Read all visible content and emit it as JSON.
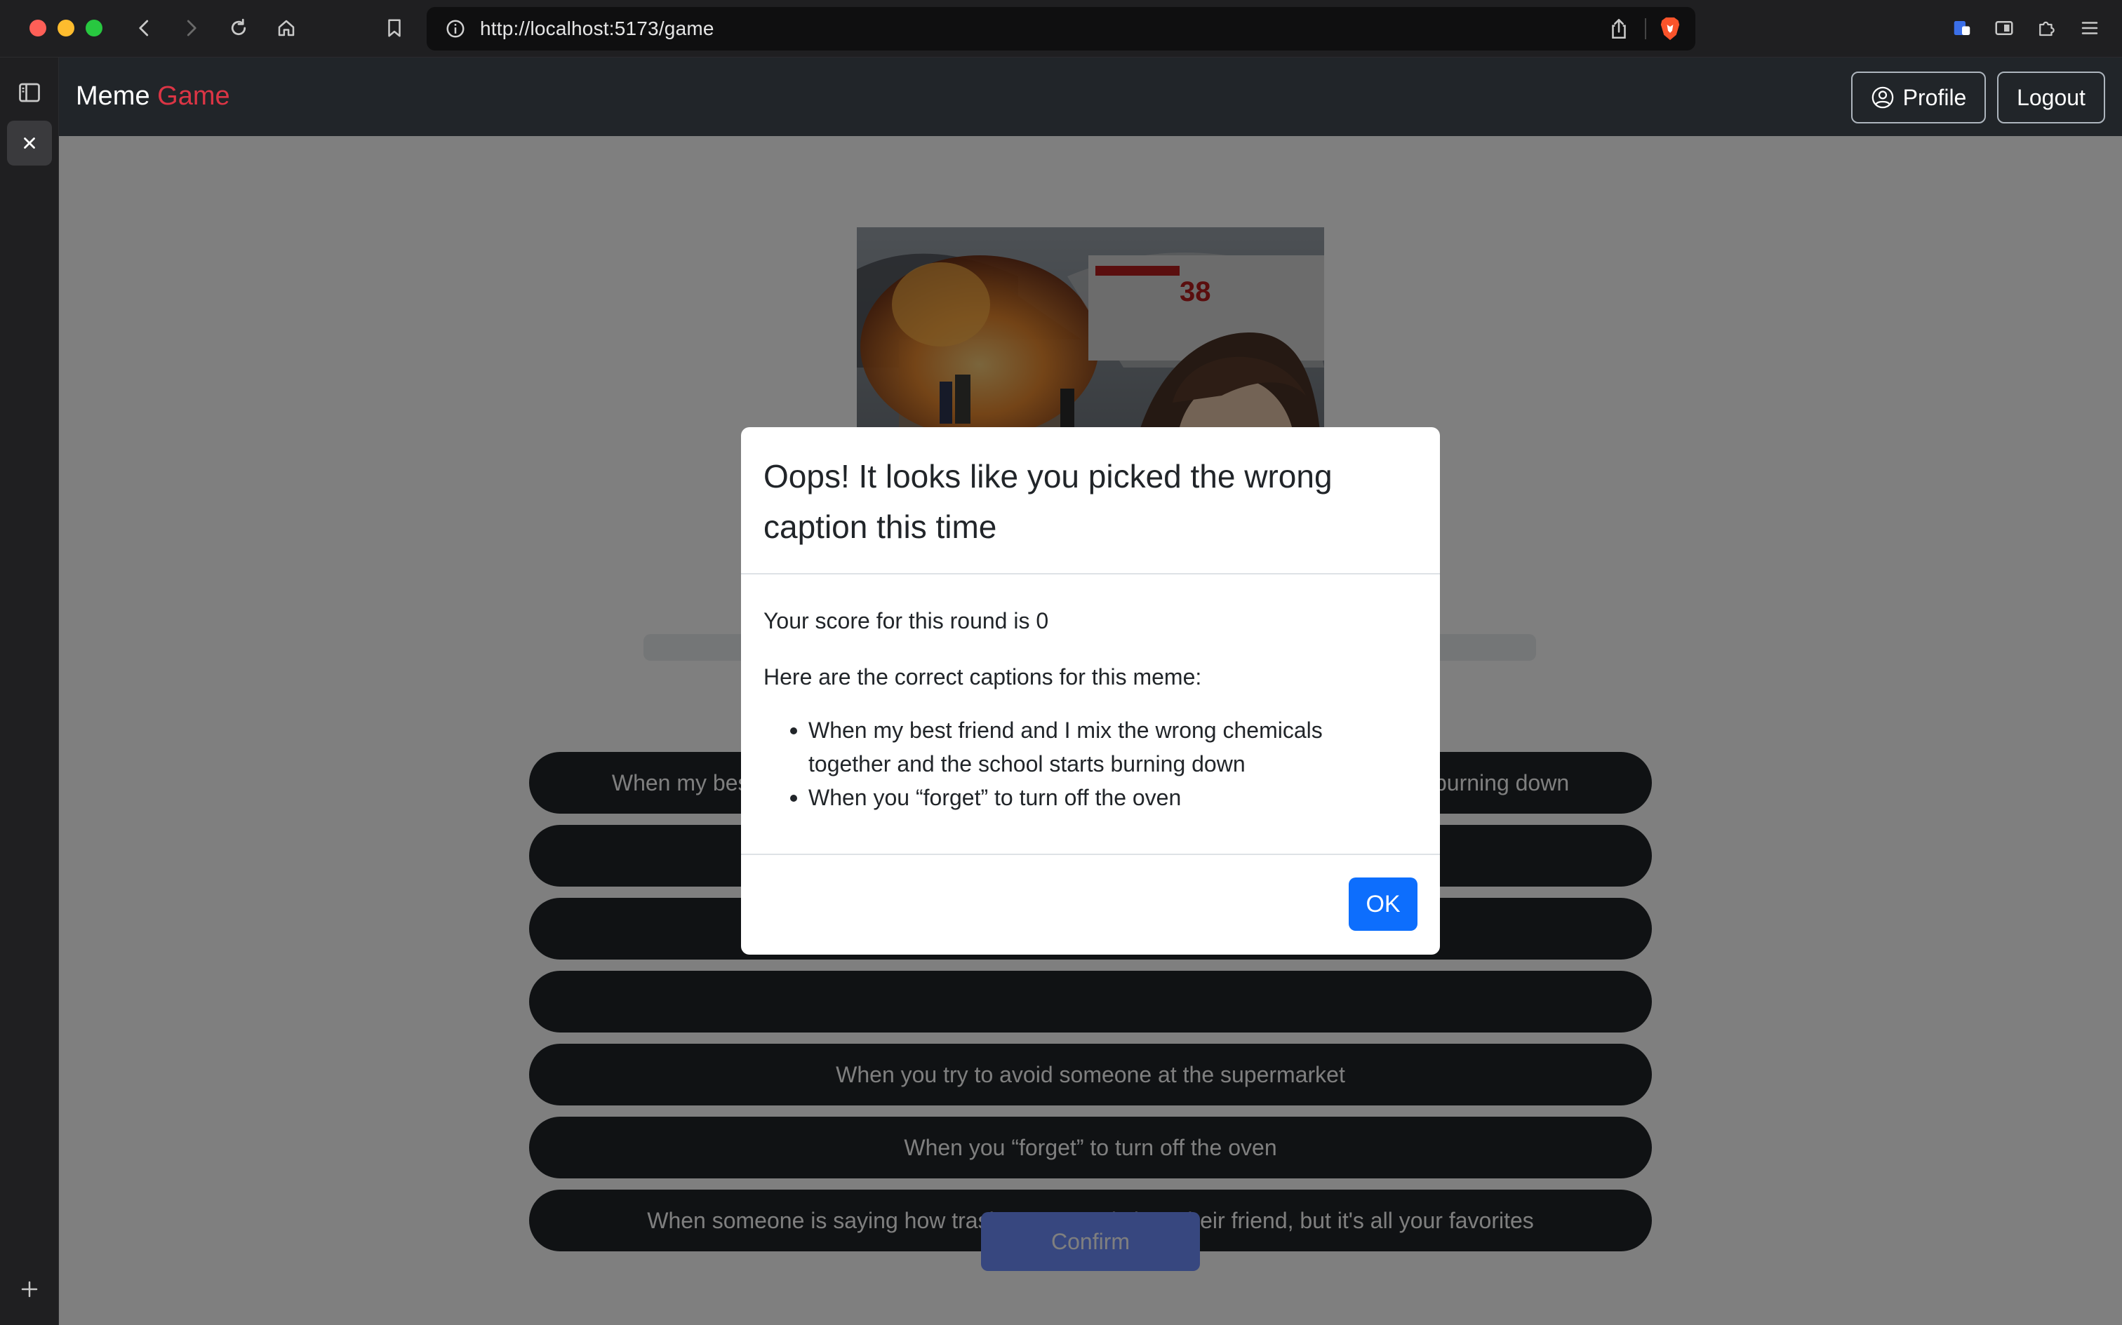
{
  "browser": {
    "url": "http://localhost:5173/game"
  },
  "navbar": {
    "brand_first": "Meme",
    "brand_second": "Game",
    "profile_label": "Profile",
    "logout_label": "Logout"
  },
  "game": {
    "captions": [
      "When my best friend and I mix the wrong chemicals together and the school starts burning down",
      "",
      "When ... y",
      "",
      "When you try to avoid someone at the supermarket",
      "When you “forget” to turn off the oven",
      "When someone is saying how trash some music is to their friend, but it's all your favorites"
    ],
    "confirm_label": "Confirm"
  },
  "modal": {
    "title": "Oops! It looks like you picked the wrong caption this time",
    "score_text": "Your score for this round is 0",
    "intro_text": "Here are the correct captions for this meme:",
    "correct_captions": [
      "When my best friend and I mix the wrong chemicals together and the school starts burning down",
      "When you “forget” to turn off the oven"
    ],
    "ok_label": "OK"
  },
  "colors": {
    "navbar_bg": "#212529",
    "brand_accent": "#dc3545",
    "primary": "#0d6efd",
    "caption_bg": "#212529"
  },
  "icons": {
    "profile": "person-circle-icon",
    "meme_image": "disaster-girl-meme-image"
  }
}
